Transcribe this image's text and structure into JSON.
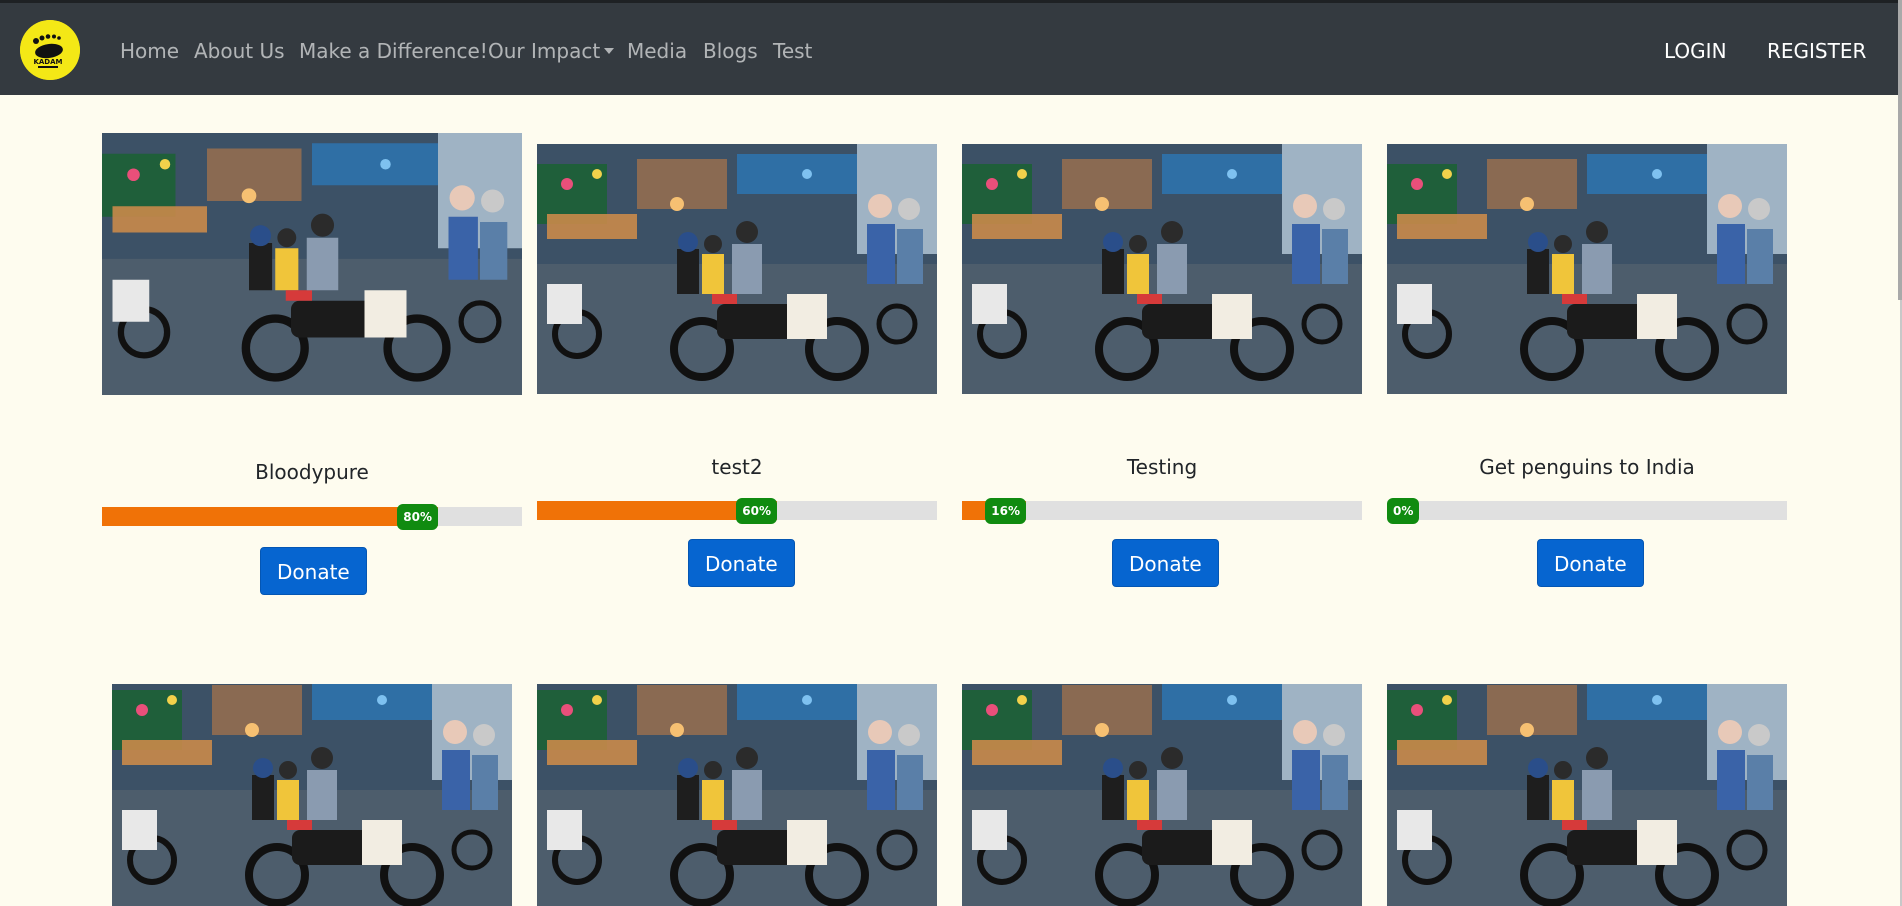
{
  "nav": {
    "logo_text": "KADAM",
    "links": [
      {
        "label": "Home"
      },
      {
        "label": "About Us"
      },
      {
        "label": "Make a Difference!"
      },
      {
        "label": "Our Impact"
      },
      {
        "label": "Media"
      },
      {
        "label": "Blogs"
      },
      {
        "label": "Test"
      }
    ],
    "login": "LOGIN",
    "register": "REGISTER"
  },
  "campaigns": [
    {
      "title": "Bloodypure",
      "progress_percent": 80,
      "progress_label": "80%",
      "button": "Donate"
    },
    {
      "title": "test2",
      "progress_percent": 60,
      "progress_label": "60%",
      "button": "Donate"
    },
    {
      "title": "Testing",
      "progress_percent": 16,
      "progress_label": "16%",
      "button": "Donate"
    },
    {
      "title": "Get penguins to India",
      "progress_percent": 0,
      "progress_label": "0%",
      "button": "Donate"
    }
  ],
  "second_row_count": 4,
  "colors": {
    "navbar": "#343a40",
    "page_background": "#fefcef",
    "progress_fill": "#f07207",
    "progress_badge": "#108b10",
    "donate_button": "#0665d0"
  }
}
